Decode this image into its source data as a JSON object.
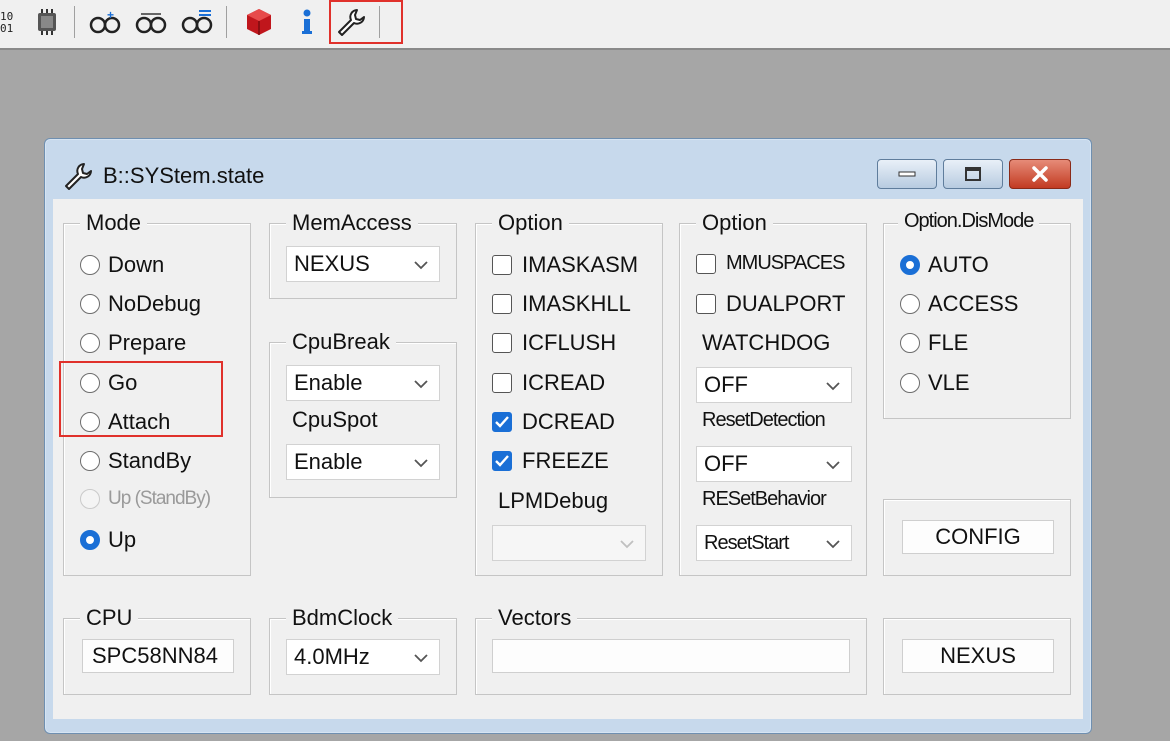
{
  "toolbar": {
    "icons": [
      "binary-icon",
      "chip-icon",
      "glasses-add-icon",
      "glasses-icon",
      "glasses-list-icon",
      "red-cube-icon",
      "info-icon",
      "wrench-icon"
    ]
  },
  "window": {
    "title": "B::SYStem.state",
    "buttons": [
      "minimize",
      "maximize",
      "close"
    ]
  },
  "mode": {
    "title": "Mode",
    "options": [
      "Down",
      "NoDebug",
      "Prepare",
      "Go",
      "Attach",
      "StandBy",
      "Up (StandBy)",
      "Up"
    ],
    "selected": "Up",
    "disabled": [
      "Up (StandBy)"
    ]
  },
  "memaccess": {
    "title": "MemAccess",
    "value": "NEXUS"
  },
  "cpubreak": {
    "title": "CpuBreak",
    "value": "Enable"
  },
  "cpuspot": {
    "title": "CpuSpot",
    "value": "Enable"
  },
  "option1": {
    "title": "Option",
    "items": [
      {
        "label": "IMASKASM",
        "checked": false
      },
      {
        "label": "IMASKHLL",
        "checked": false
      },
      {
        "label": "ICFLUSH",
        "checked": false
      },
      {
        "label": "ICREAD",
        "checked": false
      },
      {
        "label": "DCREAD",
        "checked": true
      },
      {
        "label": "FREEZE",
        "checked": true
      }
    ]
  },
  "lpmdebug": {
    "title": "LPMDebug",
    "value": ""
  },
  "option2": {
    "title": "Option",
    "items": [
      {
        "label": "MMUSPACES",
        "checked": false
      },
      {
        "label": "DUALPORT",
        "checked": false
      }
    ]
  },
  "watchdog": {
    "title": "WATCHDOG",
    "value": "OFF"
  },
  "resetdetection": {
    "title": "ResetDetection",
    "value": "OFF"
  },
  "resetbehavior": {
    "title": "RESetBehavior",
    "value": "ResetStart"
  },
  "dismode": {
    "title": "Option.DisMode",
    "options": [
      "AUTO",
      "ACCESS",
      "FLE",
      "VLE"
    ],
    "selected": "AUTO"
  },
  "config_button": "CONFIG",
  "cpu": {
    "title": "CPU",
    "value": "SPC58NN84"
  },
  "bdmclock": {
    "title": "BdmClock",
    "value": "4.0MHz"
  },
  "vectors": {
    "title": "Vectors",
    "value": ""
  },
  "nexus_button": "NEXUS",
  "colors": {
    "accent": "#1a6fd6",
    "highlight": "#e0312b",
    "close_button": "#c94a33"
  }
}
